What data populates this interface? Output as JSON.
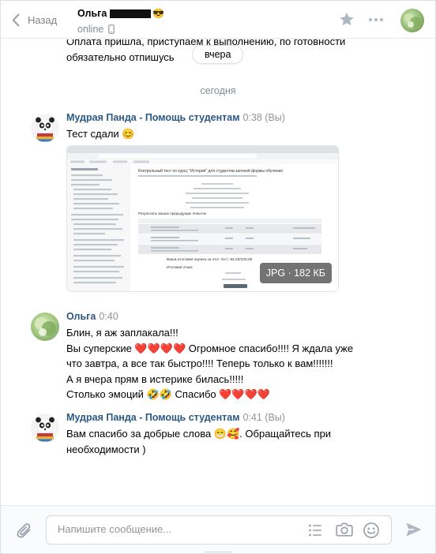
{
  "header": {
    "back_label": "Назад",
    "peer_name": "Ольга",
    "peer_emoji": "😎",
    "status": "online"
  },
  "history": {
    "previous_message_text": "Оплата пришла, приступаем к выполнению, по готовности обязательно отпишусь",
    "date_pill": "вчера",
    "date_separator": "сегодня"
  },
  "messages": [
    {
      "author": "Мудрая Панда - Помощь студентам",
      "time": "0:38 (Вы)",
      "lines": [
        "Тест сдали 😊"
      ],
      "attachment": {
        "type": "JPG",
        "badge": "JPG · 182 КБ"
      }
    },
    {
      "author": "Ольга",
      "time": "0:40",
      "lines": [
        "Блин, я аж заплакала!!!",
        "Вы суперские ❤️❤️❤️❤️ Огромное спасибо!!!! Я ждала уже",
        "что завтра, а все так быстро!!!! Теперь только к вам!!!!!!!",
        "А я вчера прям в истерике билась!!!!!",
        "Столько эмоций 🤣🤣 Спасибо ❤️❤️❤️❤️"
      ]
    },
    {
      "author": "Мудрая Панда - Помощь студентам",
      "time": "0:41 (Вы)",
      "lines": [
        "Вам спасибо за добрые слова 😁🥰. Обращайтесь при",
        "необходимости )"
      ]
    }
  ],
  "screenshot_preview": {
    "page_heading": "Контрольный тест по курсу \"История\" для студентов заочной формы обучения",
    "results_heading": "Результаты ваших предыдущих попыток",
    "final_grade_text": "Ваша итоговая оценка за этот тест: 92,03/100,00",
    "feedback_heading": "Итоговый отзыв"
  },
  "composer": {
    "placeholder": "Напишите сообщение..."
  },
  "colors": {
    "link": "#2a5885",
    "muted": "#818c99",
    "border": "#dce1e6",
    "heart": "#ea5a2c"
  }
}
